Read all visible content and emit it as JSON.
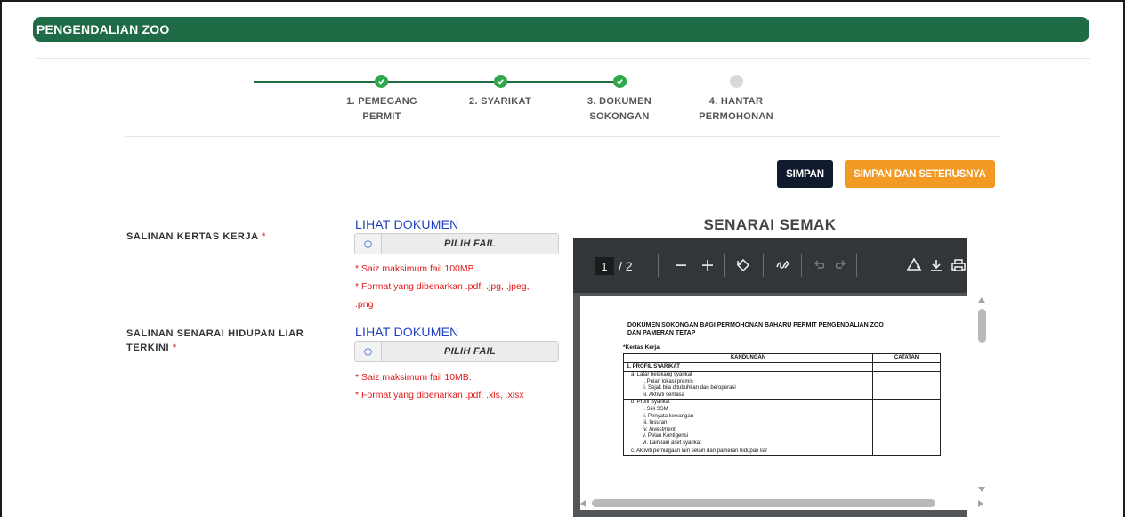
{
  "header": {
    "title": "PENGENDALIAN ZOO"
  },
  "stepper": {
    "steps": [
      {
        "line1": "1. PEMEGANG",
        "line2": "PERMIT",
        "done": true
      },
      {
        "line1": "2. SYARIKAT",
        "line2": "",
        "done": true
      },
      {
        "line1": "3. DOKUMEN",
        "line2": "SOKONGAN",
        "done": true
      },
      {
        "line1": "4. HANTAR",
        "line2": "PERMOHONAN",
        "done": false
      }
    ]
  },
  "actions": {
    "save_label": "SIMPAN",
    "save_next_label": "SIMPAN DAN SETERUSNYA"
  },
  "fields": [
    {
      "label": "SALINAN KERTAS KERJA",
      "required_mark": "*",
      "view_link": "LIHAT DOKUMEN",
      "file_button": "PILIH FAIL",
      "notes": [
        "* Saiz maksimum fail 100MB.",
        "* Format yang dibenarkan .pdf, .jpg, .jpeg,",
        ".png"
      ]
    },
    {
      "label_line1": "SALINAN SENARAI HIDUPAN LIAR",
      "label_line2": "TERKINI",
      "required_mark": "*",
      "view_link": "LIHAT DOKUMEN",
      "file_button": "PILIH FAIL",
      "notes": [
        "* Saiz maksimum fail 10MB.",
        "* Format yang dibenarkan .pdf, .xls, .xlsx"
      ]
    }
  ],
  "viewer": {
    "title": "SENARAI SEMAK",
    "current_page": "1",
    "total_pages": "/ 2",
    "doc": {
      "title_line1": "DOKUMEN SOKONGAN BAGI PERMOHONAN BAHARU PERMIT PENGENDALIAN ZOO",
      "title_line2": "DAN PAMERAN TETAP",
      "subtitle": "*Kertas Kerja",
      "col1": "KANDUNGAN",
      "col2": "CATATAN",
      "section": "1. PROFIL SYARIKAT",
      "group_a": [
        "a.   Latar belakang syarikat",
        "i.  Pelan lokasi premis",
        "ii. Sejak bila ditubuhkan dan beroperasi",
        "iii. Aktiviti semasa"
      ],
      "group_b": [
        "b. Profil Syarikat",
        "i.   Sijil SSM",
        "ii.  Penyata kewangan",
        "iii. Insuran",
        "iv. Investment",
        "v.  Pelan Kontigensi",
        "vi. Lain-lain aset syarikat"
      ],
      "group_c": "c. Aktiviti perniagaan lain selain dari pameran hidupan liar"
    }
  },
  "colors": {
    "header_bg": "#1e6b46",
    "step_done": "#2ea84a",
    "save_bg": "#0f1b2d",
    "save_next_bg": "#f39a25",
    "note_red": "#e21b1b",
    "link_blue": "#1f3fbf"
  }
}
